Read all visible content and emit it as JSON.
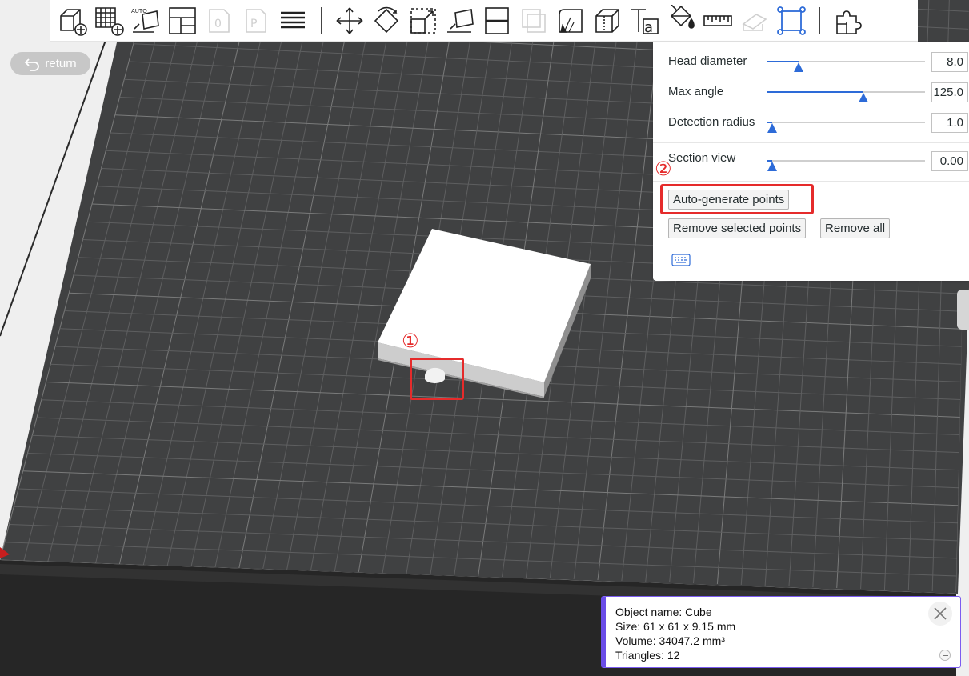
{
  "toolbar": {
    "tools": [
      "add-cube-icon",
      "grid-add-icon",
      "auto-orient-icon",
      "arrange-icon",
      "plate-slot-icon",
      "plate-p-icon",
      "layers-icon",
      "move-icon",
      "rotate-icon",
      "scale-icon",
      "lay-on-face-icon",
      "cut-icon",
      "hollow-icon",
      "measure-support-icon",
      "seam-icon",
      "text-icon",
      "paint-bucket-icon",
      "ruler-icon",
      "eraser-icon",
      "sla-support-points-icon",
      "assembly-icon"
    ]
  },
  "return_button": {
    "label": "return"
  },
  "gizmo": {
    "params": [
      {
        "label": "Head diameter",
        "value": "8.0",
        "fraction": 0.2
      },
      {
        "label": "Max angle",
        "value": "125.0",
        "fraction": 0.61
      },
      {
        "label": "Detection radius",
        "value": "1.0",
        "fraction": 0.03
      }
    ],
    "section_view": {
      "label": "Section view",
      "value": "0.00",
      "fraction": 0.03
    },
    "auto_generate_label": "Auto-generate points",
    "remove_selected_label": "Remove selected points",
    "remove_all_label": "Remove all"
  },
  "annotations": {
    "one": "①",
    "two": "②"
  },
  "info": {
    "object_name": "Object name: Cube",
    "size": "Size: 61 x 61 x 9.15 mm",
    "volume": "Volume: 34047.2 mm³",
    "triangles": "Triangles: 12"
  },
  "colors": {
    "accent": "#2d6bd8",
    "annotation": "#e52b2b",
    "info_border": "#6a4de8",
    "bed": "#404142",
    "grid_line": "#5f6060"
  }
}
